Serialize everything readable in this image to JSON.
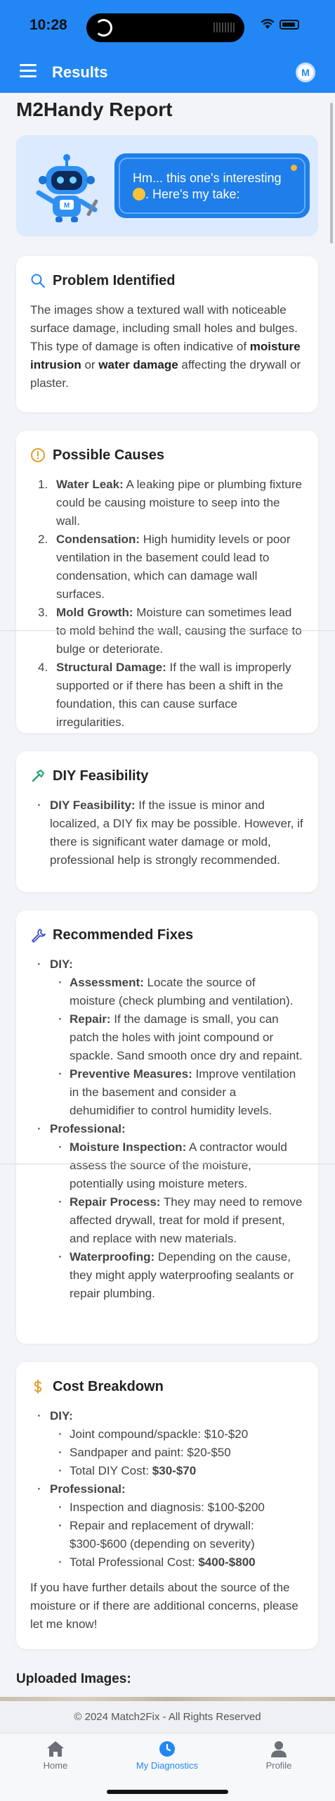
{
  "status_bar": {
    "time": "10:28"
  },
  "app_bar": {
    "title": "Results",
    "avatar_letter": "M"
  },
  "page_title": "M2Handy Report",
  "hero": {
    "bubble_text_1": "Hm... this one's interesting",
    "bubble_text_2": ". Here's my take:"
  },
  "problem": {
    "title": "Problem Identified",
    "text_1": "The images show a textured wall with noticeable surface damage, including small holes and bulges. This type of damage is often indicative of ",
    "bold_1": "moisture intrusion",
    "text_2": " or ",
    "bold_2": "water damage",
    "text_3": " affecting the drywall or plaster."
  },
  "causes": {
    "title": "Possible Causes",
    "items": [
      {
        "num": "1.",
        "label": "Water Leak:",
        "text": " A leaking pipe or plumbing fixture could be causing moisture to seep into the wall."
      },
      {
        "num": "2.",
        "label": "Condensation:",
        "text": " High humidity levels or poor ventilation in the basement could lead to condensation, which can damage wall surfaces."
      },
      {
        "num": "3.",
        "label": "Mold Growth:",
        "text": " Moisture can sometimes lead to mold behind the wall, causing the surface to bulge or deteriorate."
      },
      {
        "num": "4.",
        "label": "Structural Damage:",
        "text": " If the wall is improperly supported or if there has been a shift in the foundation, this can cause surface irregularities."
      }
    ]
  },
  "diy": {
    "title": "DIY Feasibility",
    "label": "DIY Feasibility:",
    "text": " If the issue is minor and localized, a DIY fix may be possible. However, if there is significant water damage or mold, professional help is strongly recommended."
  },
  "fixes": {
    "title": "Recommended Fixes",
    "diy_label": "DIY:",
    "diy_items": [
      {
        "label": "Assessment:",
        "text": " Locate the source of moisture (check plumbing and ventilation)."
      },
      {
        "label": "Repair:",
        "text": " If the damage is small, you can patch the holes with joint compound or spackle. Sand smooth once dry and repaint."
      },
      {
        "label": "Preventive Measures:",
        "text": " Improve ventilation in the basement and consider a dehumidifier to control humidity levels."
      }
    ],
    "pro_label": "Professional:",
    "pro_items": [
      {
        "label": "Moisture Inspection:",
        "text": " A contractor would assess the source of the moisture, potentially using moisture meters."
      },
      {
        "label": "Repair Process:",
        "text": " They may need to remove affected drywall, treat for mold if present, and replace with new materials."
      },
      {
        "label": "Waterproofing:",
        "text": " Depending on the cause, they might apply waterproofing sealants or repair plumbing."
      }
    ]
  },
  "cost": {
    "title": "Cost Breakdown",
    "diy_label": "DIY:",
    "diy_items": [
      "Joint compound/spackle: $10-$20",
      "Sandpaper and paint: $20-$50"
    ],
    "diy_total_label": "Total DIY Cost: ",
    "diy_total_value": "$30-$70",
    "pro_label": "Professional:",
    "pro_items": [
      "Inspection and diagnosis: $100-$200",
      "Repair and replacement of drywall: $300-$600 (depending on severity)"
    ],
    "pro_total_label": "Total Professional Cost: ",
    "pro_total_value": "$400-$800",
    "closing": "If you have further details about the source of the moisture or if there are additional concerns, please let me know!"
  },
  "uploaded_title": "Uploaded Images:",
  "footer": "© 2024 Match2Fix - All Rights Reserved",
  "tabs": {
    "home": "Home",
    "diagnostics": "My Diagnostics",
    "profile": "Profile"
  },
  "colors": {
    "primary": "#2287f5",
    "hero_bg": "#dbeafe",
    "bubble": "#1f7ee9",
    "cause_icon": "#e0a030",
    "cost_icon": "#e0a030"
  }
}
